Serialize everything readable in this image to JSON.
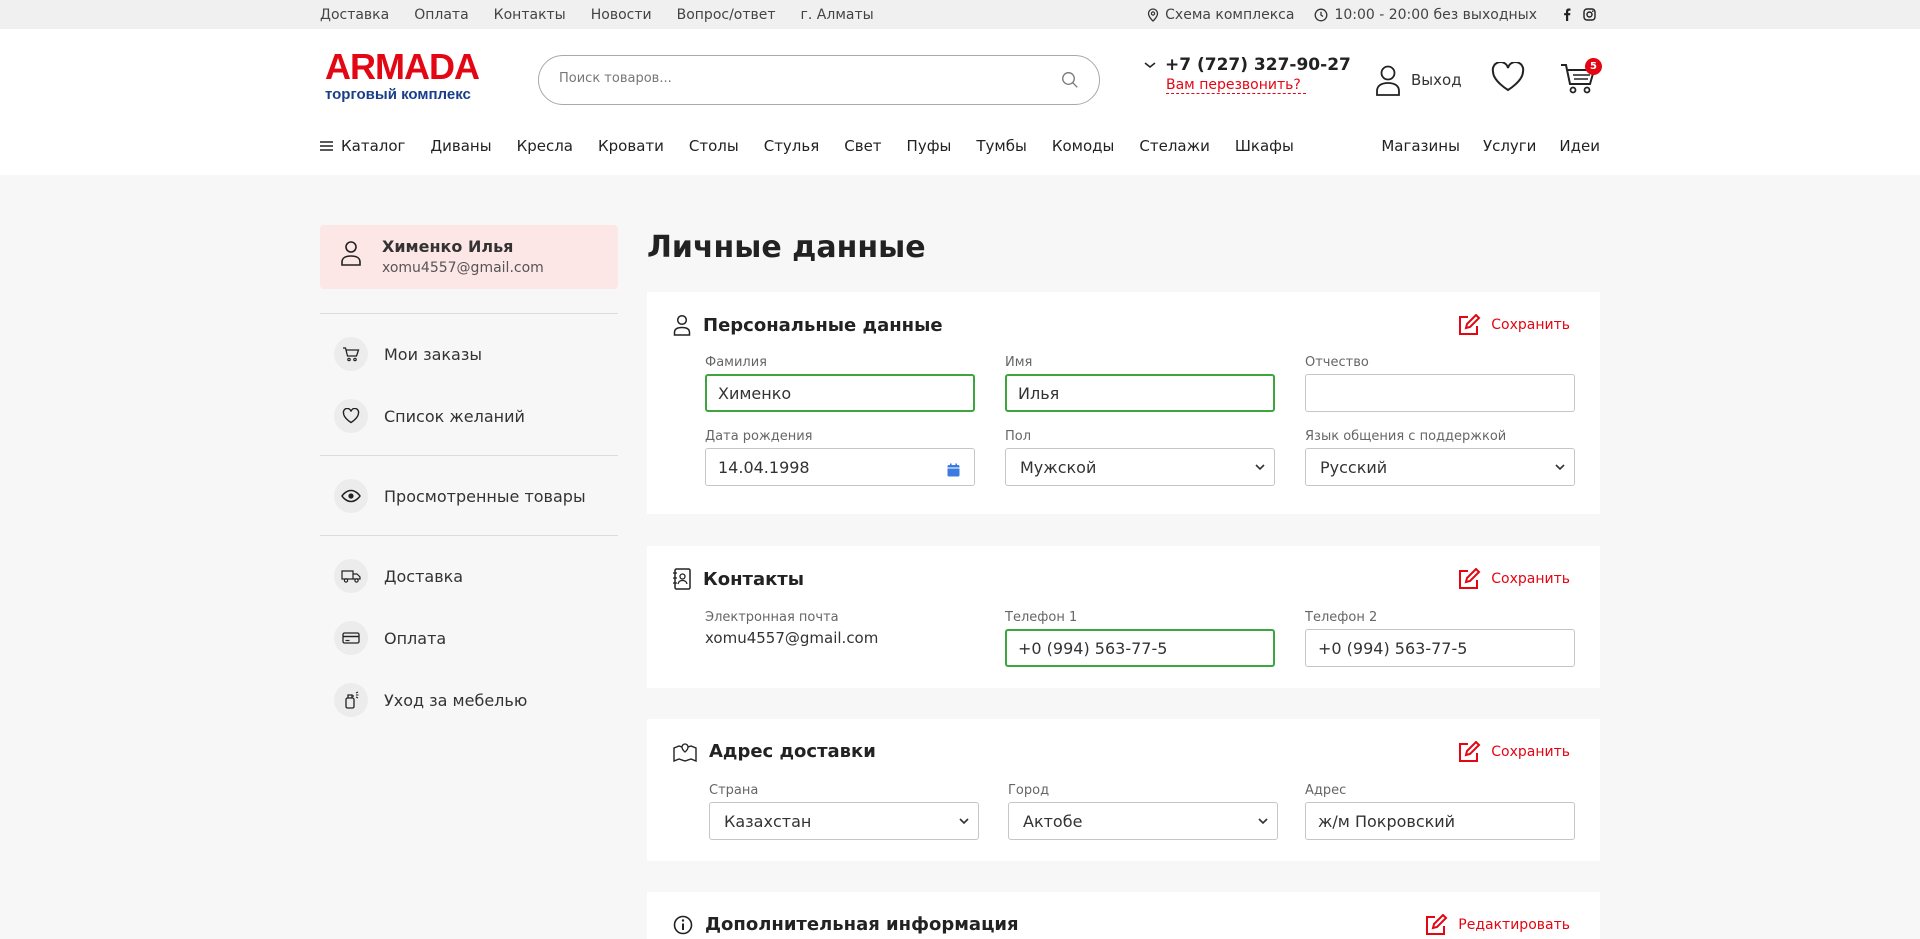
{
  "topbar": {
    "links": [
      "Доставка",
      "Оплата",
      "Контакты",
      "Новости",
      "Вопрос/ответ",
      "г. Алматы"
    ],
    "scheme": "Схема комплекса",
    "hours": "10:00 - 20:00 без выходных"
  },
  "header": {
    "logo_brand": "ARMADA",
    "logo_sub": "торговый комплекс",
    "search_placeholder": "Поиск товаров...",
    "phone": "+7 (727) 327-90-27",
    "callback": "Вам перезвонить?",
    "logout": "Выход",
    "cart_count": "5"
  },
  "nav": {
    "catalog": "Каталог",
    "items": [
      "Диваны",
      "Кресла",
      "Кровати",
      "Столы",
      "Стулья",
      "Свет",
      "Пуфы",
      "Тумбы",
      "Комоды",
      "Стелажи",
      "Шкафы"
    ],
    "right": [
      "Магазины",
      "Услуги",
      "Идеи"
    ]
  },
  "sidebar": {
    "user_name": "Хименко Илья",
    "user_email": "xomu4557@gmail.com",
    "items": [
      "Мои заказы",
      "Список желаний",
      "Просмотренные товары",
      "Доставка",
      "Оплата",
      "Уход за мебелью"
    ]
  },
  "page": {
    "title": "Личные данные"
  },
  "personal": {
    "title": "Персональные данные",
    "save": "Сохранить",
    "surname_label": "Фамилия",
    "surname": "Хименко",
    "name_label": "Имя",
    "name": "Илья",
    "patronymic_label": "Отчество",
    "patronymic": "",
    "birth_label": "Дата рождения",
    "birth": "14.04.1998",
    "gender_label": "Пол",
    "gender": "Мужской",
    "lang_label": "Язык общения с поддержкой",
    "lang": "Русский"
  },
  "contacts": {
    "title": "Контакты",
    "save": "Сохранить",
    "email_label": "Электронная почта",
    "email": "xomu4557@gmail.com",
    "phone1_label": "Телефон 1",
    "phone1": "+0 (994) 563-77-5",
    "phone2_label": "Телефон 2",
    "phone2": "+0 (994) 563-77-5"
  },
  "address": {
    "title": "Адрес доставки",
    "save": "Сохранить",
    "country_label": "Страна",
    "country": "Казахстан",
    "city_label": "Город",
    "city": "Актобе",
    "addr_label": "Адрес",
    "addr": "ж/м Покровский"
  },
  "extra": {
    "title": "Дополнительная информация",
    "edit": "Редактировать"
  },
  "colors": {
    "accent": "#e30613",
    "valid": "#3da53d",
    "brand_blue": "#1b3e8a"
  }
}
